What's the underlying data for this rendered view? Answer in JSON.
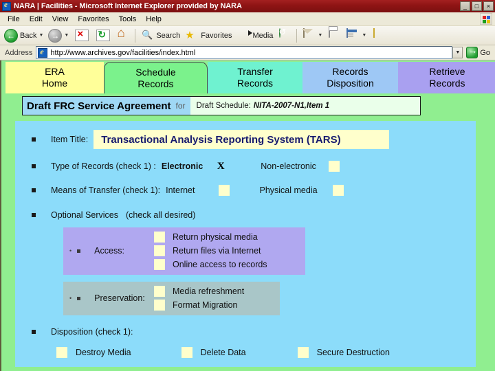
{
  "window": {
    "title": "NARA | Facilities - Microsoft Internet Explorer provided by NARA",
    "minimize_label": "_",
    "maximize_label": "□",
    "close_label": "×"
  },
  "menu": {
    "items": [
      {
        "label": "File"
      },
      {
        "label": "Edit"
      },
      {
        "label": "View"
      },
      {
        "label": "Favorites"
      },
      {
        "label": "Tools"
      },
      {
        "label": "Help"
      }
    ]
  },
  "toolbar": {
    "back_label": "Back",
    "search_label": "Search",
    "favorites_label": "Favorites",
    "media_label": "Media"
  },
  "address": {
    "label": "Address",
    "url": "http://www.archives.gov/facilities/index.html",
    "go_label": "Go"
  },
  "tabs": [
    {
      "line1": "ERA",
      "line2": "Home",
      "color": "#ffff99",
      "active": false
    },
    {
      "line1": "Schedule",
      "line2": "Records",
      "color": "#7bf28c",
      "active": true
    },
    {
      "line1": "Transfer",
      "line2": "Records",
      "color": "#6ff2d0",
      "active": false
    },
    {
      "line1": "Records",
      "line2": "Disposition",
      "color": "#9ec8f5",
      "active": false
    },
    {
      "line1": "Retrieve",
      "line2": "Records",
      "color": "#a9a0f0",
      "active": false
    }
  ],
  "header": {
    "main_title": "Draft FRC Service Agreement",
    "for_word": "for",
    "schedule_prefix": "Draft Schedule:",
    "schedule_id": "NITA-2007-N1,",
    "schedule_item": "Item 1"
  },
  "form": {
    "item_title_label": "Item Title:",
    "item_title_value": "Transactional Analysis Reporting System (TARS)",
    "type_label": "Type of Records (check 1) :",
    "type_option_1": "Electronic",
    "type_option_1_mark": "X",
    "type_option_2": "Non-electronic",
    "means_label": "Means of Transfer (check 1):",
    "means_option_1": "Internet",
    "means_option_2": "Physical media",
    "optional_label": "Optional Services",
    "optional_hint": "(check all desired)",
    "access_label": "Access:",
    "access_options": [
      "Return physical media",
      "Return files via Internet",
      "Online access to records"
    ],
    "preservation_label": "Preservation:",
    "preservation_options": [
      "Media refreshment",
      "Format Migration"
    ],
    "disposition_label": "Disposition (check 1):",
    "disposition_options": [
      "Destroy Media",
      "Delete Data",
      "Secure Destruction"
    ]
  },
  "colors": {
    "title_bar": "#8e1414",
    "page_background": "#90ee90",
    "form_panel": "#8cdcfa",
    "checkbox": "#ffffcc",
    "access_block": "#b0a8f0",
    "preservation_block": "#a9c6c8",
    "item_title_text": "#161a6e",
    "header_left": "#9fd8f5"
  }
}
